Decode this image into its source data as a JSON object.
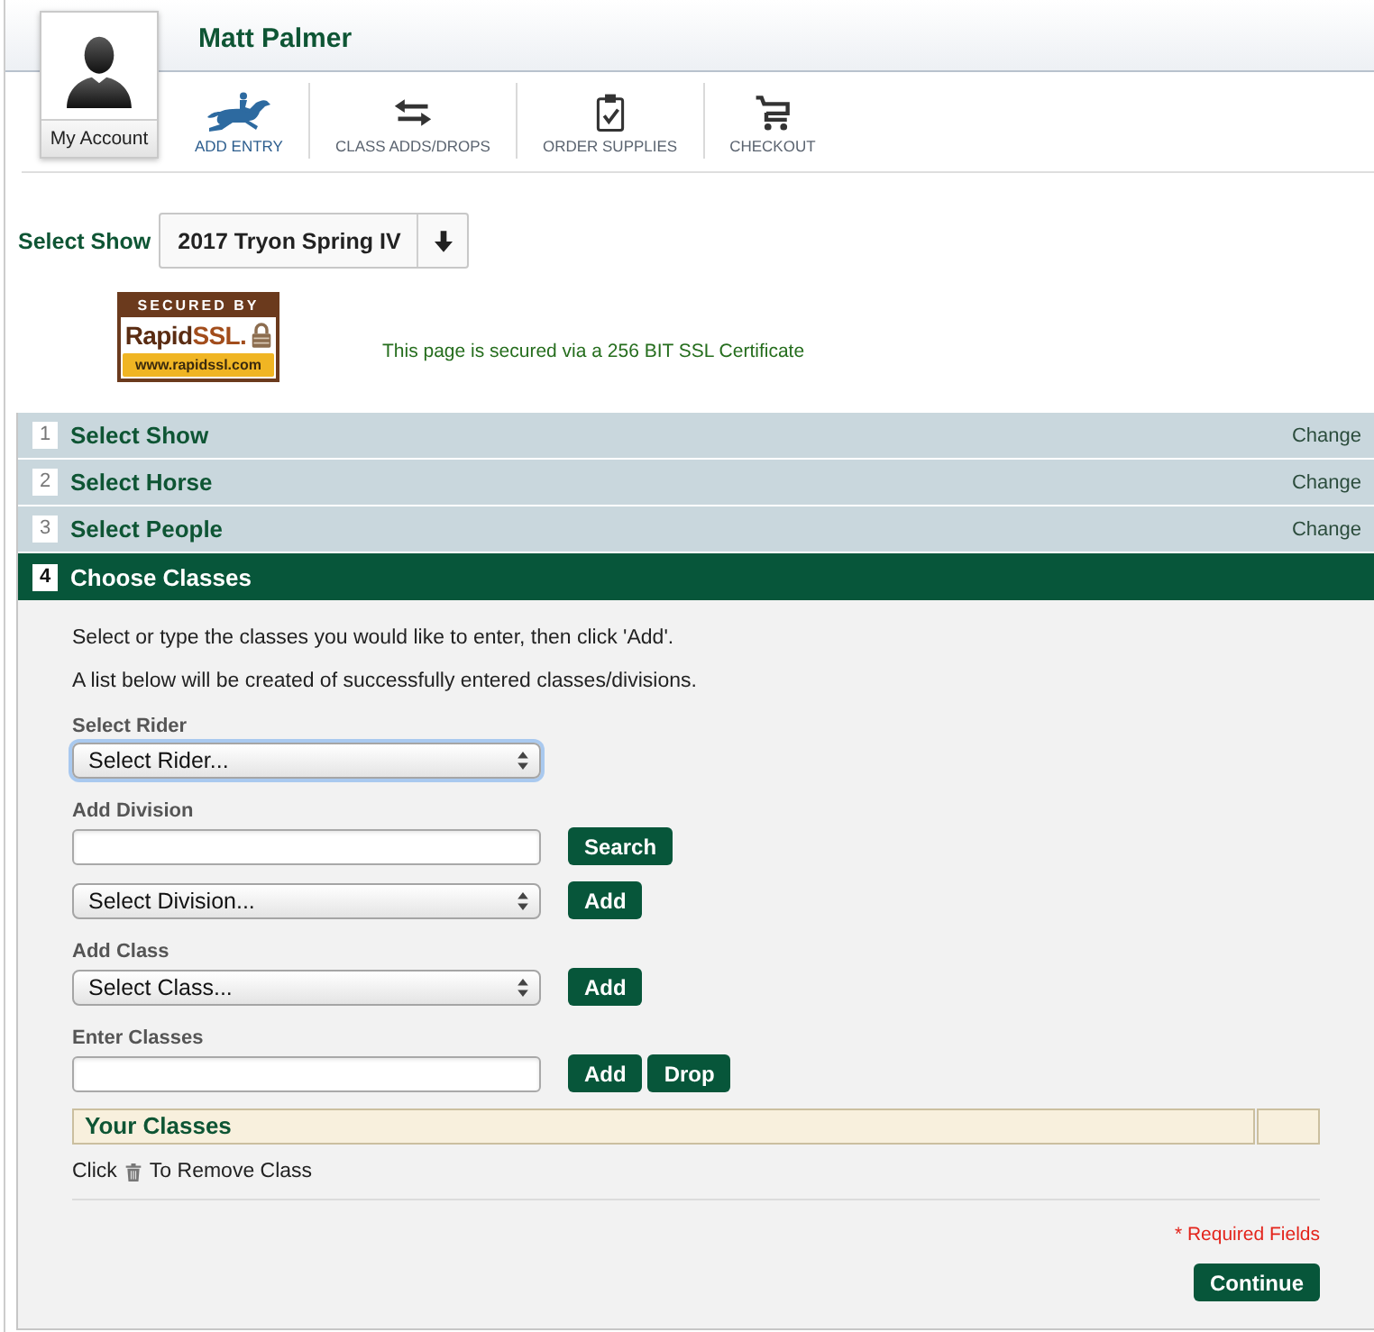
{
  "header": {
    "user_name": "Matt Palmer",
    "account_button": "My Account",
    "nav": [
      {
        "label": "ADD ENTRY",
        "selected": true
      },
      {
        "label": "CLASS ADDS/DROPS",
        "selected": false
      },
      {
        "label": "ORDER SUPPLIES",
        "selected": false
      },
      {
        "label": "CHECKOUT",
        "selected": false
      }
    ]
  },
  "show_selector": {
    "label": "Select Show",
    "value": "2017 Tryon Spring IV"
  },
  "security": {
    "badge": {
      "top": "SECURED BY",
      "brand": "Rapid",
      "brand_suffix": "SSL.",
      "url": "www.rapidssl.com"
    },
    "message": "This page is secured via a 256 BIT SSL Certificate"
  },
  "steps": [
    {
      "number": "1",
      "title": "Select Show",
      "action": "Change",
      "selected": false
    },
    {
      "number": "2",
      "title": "Select Horse",
      "action": "Change",
      "selected": false
    },
    {
      "number": "3",
      "title": "Select People",
      "action": "Change",
      "selected": false
    },
    {
      "number": "4",
      "title": "Choose Classes",
      "selected": true
    }
  ],
  "choose_classes": {
    "intro": [
      "Select or type the classes you would like to enter, then click 'Add'.",
      "A list below will be created of successfully entered classes/divisions."
    ],
    "groups": [
      {
        "label": "Select Rider",
        "rows": [
          {
            "field": {
              "kind": "select",
              "value": "Select Rider...",
              "focused": true
            }
          }
        ]
      },
      {
        "label": "Add Division",
        "rows": [
          {
            "field": {
              "kind": "text",
              "focused": false
            },
            "buttons": [
              "Search"
            ]
          },
          {
            "field": {
              "kind": "select",
              "value": "Select Division...",
              "focused": false
            },
            "buttons": [
              "Add"
            ]
          }
        ]
      },
      {
        "label": "Add Class",
        "rows": [
          {
            "field": {
              "kind": "select",
              "value": "Select Class...",
              "focused": false
            },
            "buttons": [
              "Add"
            ]
          }
        ]
      },
      {
        "label": "Enter Classes",
        "rows": [
          {
            "field": {
              "kind": "text",
              "focused": false
            },
            "buttons": [
              "Add",
              "Drop"
            ]
          }
        ]
      }
    ],
    "your_classes": {
      "title": "Your Classes"
    },
    "remove_hint": {
      "before": "Click",
      "after": "To Remove Class"
    },
    "required_note": "* Required Fields",
    "continue_button": "Continue"
  }
}
